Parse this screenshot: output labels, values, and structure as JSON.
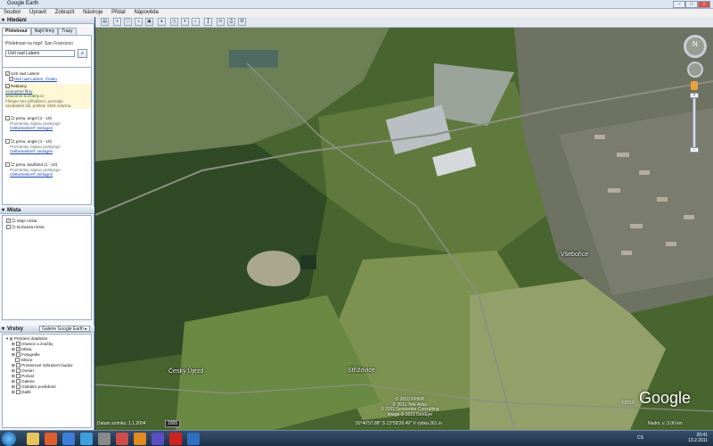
{
  "window": {
    "title": "Google Earth"
  },
  "menu": [
    "Soubor",
    "Úpravit",
    "Zobrazit",
    "Nástroje",
    "Přidat",
    "Nápověda"
  ],
  "search_panel": {
    "header": "Hledání",
    "tabs": [
      "Přeletnout",
      "Najít firmy",
      "Trasy"
    ],
    "hint": "Přeletnout na např. San Francisco",
    "query": "Ústí nad Labem",
    "results": [
      {
        "title": "Ústí nad Labem",
        "sub": "Ústí nad Labem, Česko"
      },
      {
        "title": "Reklamy",
        "sub": "Anonymní flirty",
        "line3": "www.sms-kontakty.cz",
        "line4": "Flirtujte bez přihlášení, poznejte",
        "line5": "neodaleké lidi, pošlete SMS zdarma."
      },
      {
        "title": "pirna, angel (1 - 10)",
        "sub": "Poznámky zápisu poskytuje",
        "line3": "GelbeSeiten® Verlagen"
      },
      {
        "title": "pirna, angle (1 - 10)",
        "sub": "Poznámky zápisu poskytuje",
        "line3": "GelbeSeiten® Verlagen"
      },
      {
        "title": "pirna, kaufland (1 - 10)",
        "sub": "Poznámky zápisu poskytuje",
        "line3": "GelbeSeiten® Verlagen"
      }
    ]
  },
  "places_panel": {
    "header": "Místa",
    "items": [
      "Moje místa",
      "Dočasná místa"
    ]
  },
  "layers_panel": {
    "header": "Vrstvy",
    "tab": "Galerie Google Earth ▸",
    "items": [
      "Primární databáze",
      "Hranice a značky",
      "Místa",
      "Fotografie",
      "Silnice",
      "Prostorové zobrazení budov",
      "Oceán",
      "Počasí",
      "Galerie",
      "Globální povědomí",
      "Další"
    ]
  },
  "map": {
    "labels": [
      "Všebořice",
      "Český Újezd",
      "Střížovice"
    ],
    "logo": "Google",
    "copyright": [
      "© 2010 PPWK",
      "© 2011 Tele Atlas",
      "© 2011 Geocentre Consulting",
      "Image © 2011 GeoEye"
    ],
    "imagery_date": "Datum snímku: 1.1.2004",
    "year": "2005",
    "coordinates": "50°40'57.88\" S  13°58'28.49\" V  výška  261 m",
    "eye_alt": "Nadm. v. 3.00 km",
    "logo_year": "©2010"
  },
  "taskbar": {
    "lang": "CS",
    "time": "20:41",
    "date": "13.2.2011"
  }
}
